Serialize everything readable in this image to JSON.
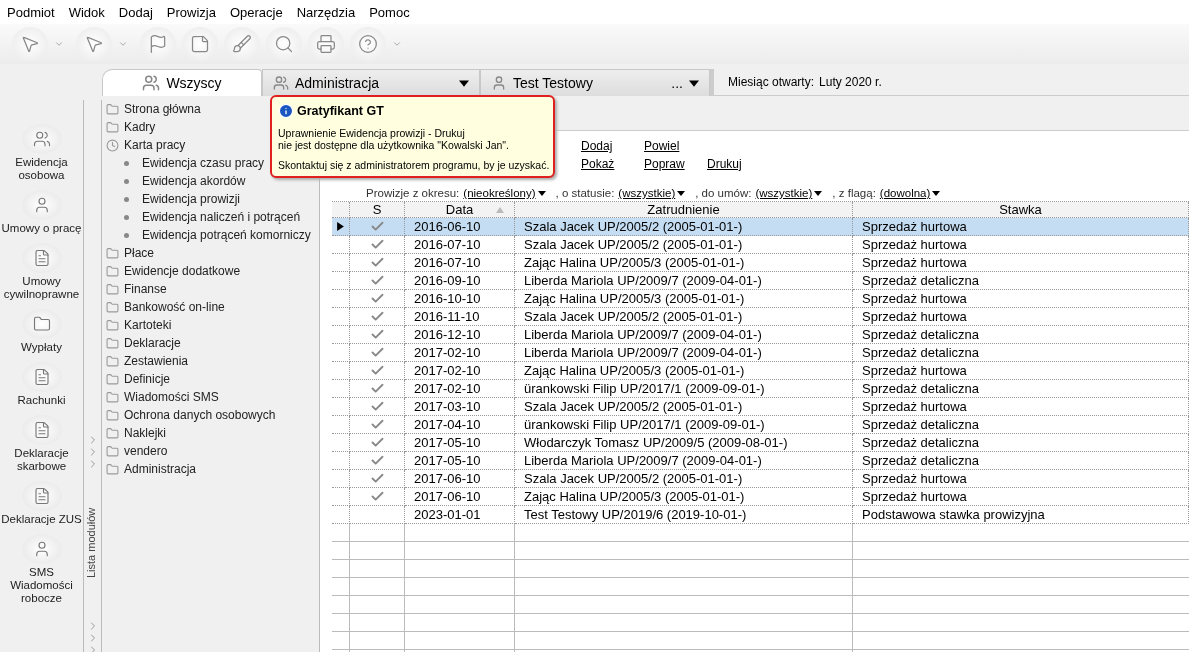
{
  "menu": [
    "Podmiot",
    "Widok",
    "Dodaj",
    "Prowizja",
    "Operacje",
    "Narzędzia",
    "Pomoc"
  ],
  "tabs": [
    {
      "label": "Wszyscy",
      "selected": true,
      "kind": "plain"
    },
    {
      "label": "Administracja",
      "selected": false,
      "kind": "dropdown"
    },
    {
      "label": "Test Testowy",
      "selected": false,
      "kind": "more",
      "more": "..."
    }
  ],
  "status": {
    "label": "Miesiąc otwarty:",
    "value": "Luty 2020 r."
  },
  "left_strip": [
    {
      "label": "Ewidencja osobowa"
    },
    {
      "label": "Umowy o pracę"
    },
    {
      "label": "Umowy cywilnoprawne"
    },
    {
      "label": "Wypłaty"
    },
    {
      "label": "Rachunki"
    },
    {
      "label": "Deklaracje skarbowe"
    },
    {
      "label": "Deklaracje ZUS"
    },
    {
      "label": "SMS Wiadomości robocze"
    }
  ],
  "module_panel": {
    "title": "Lista modułów",
    "items": [
      {
        "label": "Strona główna"
      },
      {
        "label": "Kadry"
      },
      {
        "label": "Karta pracy",
        "children": [
          {
            "label": "Ewidencja czasu pracy"
          },
          {
            "label": "Ewidencja akordów"
          },
          {
            "label": "Ewidencja prowizji"
          },
          {
            "label": "Ewidencja naliczeń i potrąceń"
          },
          {
            "label": "Ewidencja potrąceń komorniczy"
          }
        ]
      },
      {
        "label": "Płace"
      },
      {
        "label": "Ewidencje dodatkowe"
      },
      {
        "label": "Finanse"
      },
      {
        "label": "Bankowość on-line"
      },
      {
        "label": "Kartoteki"
      },
      {
        "label": "Deklaracje"
      },
      {
        "label": "Zestawienia"
      },
      {
        "label": "Definicje"
      },
      {
        "label": "Wiadomości SMS"
      },
      {
        "label": "Ochrona danych osobowych"
      },
      {
        "label": "Naklejki"
      },
      {
        "label": "vendero"
      },
      {
        "label": "Administracja"
      }
    ]
  },
  "actions": [
    [
      "Dodaj",
      "Powiel"
    ],
    [
      "Pokaż",
      "Popraw",
      "Drukuj"
    ]
  ],
  "filters": [
    {
      "label": "Prowizje z okresu:",
      "value": "(nieokreślony)"
    },
    {
      "label": ", o statusie:",
      "value": "(wszystkie)"
    },
    {
      "label": ", do umów:",
      "value": "(wszystkie)"
    },
    {
      "label": ", z flagą:",
      "value": "(dowolna)"
    }
  ],
  "table": {
    "columns": [
      {
        "label": "S",
        "sorted": false
      },
      {
        "label": "Data",
        "sorted": true
      },
      {
        "label": "Zatrudnienie",
        "sorted": false
      },
      {
        "label": "Stawka",
        "sorted": false
      }
    ],
    "rows": [
      {
        "selected": true,
        "checked": true,
        "date": "2016-06-10",
        "employment": "Szala Jacek UP/2005/2 (2005-01-01-)",
        "rate": "Sprzedaż hurtowa"
      },
      {
        "selected": false,
        "checked": true,
        "date": "2016-07-10",
        "employment": "Szala Jacek UP/2005/2 (2005-01-01-)",
        "rate": "Sprzedaż hurtowa"
      },
      {
        "selected": false,
        "checked": true,
        "date": "2016-07-10",
        "employment": "Zając Halina UP/2005/3 (2005-01-01-)",
        "rate": "Sprzedaż hurtowa"
      },
      {
        "selected": false,
        "checked": true,
        "date": "2016-09-10",
        "employment": "Liberda Mariola UP/2009/7 (2009-04-01-)",
        "rate": "Sprzedaż detaliczna"
      },
      {
        "selected": false,
        "checked": true,
        "date": "2016-10-10",
        "employment": "Zając Halina UP/2005/3 (2005-01-01-)",
        "rate": "Sprzedaż hurtowa"
      },
      {
        "selected": false,
        "checked": true,
        "date": "2016-11-10",
        "employment": "Szala Jacek UP/2005/2 (2005-01-01-)",
        "rate": "Sprzedaż hurtowa"
      },
      {
        "selected": false,
        "checked": true,
        "date": "2016-12-10",
        "employment": "Liberda Mariola UP/2009/7 (2009-04-01-)",
        "rate": "Sprzedaż detaliczna"
      },
      {
        "selected": false,
        "checked": true,
        "date": "2017-02-10",
        "employment": "Liberda Mariola UP/2009/7 (2009-04-01-)",
        "rate": "Sprzedaż detaliczna"
      },
      {
        "selected": false,
        "checked": true,
        "date": "2017-02-10",
        "employment": "Zając Halina UP/2005/3 (2005-01-01-)",
        "rate": "Sprzedaż hurtowa"
      },
      {
        "selected": false,
        "checked": true,
        "date": "2017-02-10",
        "employment": "ürankowski Filip UP/2017/1 (2009-09-01-)",
        "rate": "Sprzedaż detaliczna"
      },
      {
        "selected": false,
        "checked": true,
        "date": "2017-03-10",
        "employment": "Szala Jacek UP/2005/2 (2005-01-01-)",
        "rate": "Sprzedaż hurtowa"
      },
      {
        "selected": false,
        "checked": true,
        "date": "2017-04-10",
        "employment": "ürankowski Filip UP/2017/1 (2009-09-01-)",
        "rate": "Sprzedaż detaliczna"
      },
      {
        "selected": false,
        "checked": true,
        "date": "2017-05-10",
        "employment": "Włodarczyk Tomasz UP/2009/5 (2009-08-01-)",
        "rate": "Sprzedaż detaliczna"
      },
      {
        "selected": false,
        "checked": true,
        "date": "2017-05-10",
        "employment": "Liberda Mariola UP/2009/7 (2009-04-01-)",
        "rate": "Sprzedaż detaliczna"
      },
      {
        "selected": false,
        "checked": true,
        "date": "2017-06-10",
        "employment": "Szala Jacek UP/2005/2 (2005-01-01-)",
        "rate": "Sprzedaż hurtowa"
      },
      {
        "selected": false,
        "checked": true,
        "date": "2017-06-10",
        "employment": "Zając Halina UP/2005/3 (2005-01-01-)",
        "rate": "Sprzedaż hurtowa"
      },
      {
        "selected": false,
        "checked": false,
        "date": "2023-01-01",
        "employment": "Test Testowy UP/2019/6 (2019-10-01-)",
        "rate": "Podstawowa stawka prowizyjna"
      }
    ]
  },
  "tooltip": {
    "title": "Gratyfikant GT",
    "paragraphs": [
      "Uprawnienie Ewidencja prowizji - Drukuj\nnie jest dostępne dla użytkownika \"Kowalski Jan\".",
      "Skontaktuj się z administratorem programu, by je uzyskać."
    ]
  }
}
